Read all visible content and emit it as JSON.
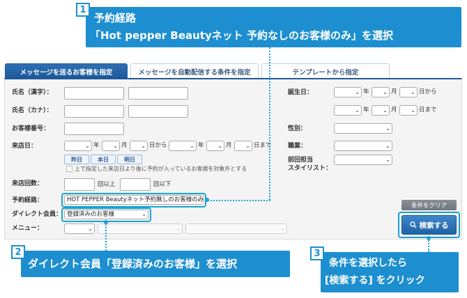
{
  "tabs": [
    {
      "label": "メッセージを送るお客様を指定"
    },
    {
      "label": "メッセージを自動配信する条件を指定"
    },
    {
      "label": "テンプレートから指定"
    }
  ],
  "form": {
    "name_kanji": "氏名（漢字）：",
    "name_kana": "氏名（カナ）：",
    "customer_no": "お客様番号：",
    "visit_date": "来店日：",
    "visit_count": "来店回数：",
    "route": "予約経路：",
    "direct_member": "ダイレクト会員：",
    "menu": "メニュー：",
    "birthday": "誕生日：",
    "gender": "性別：",
    "occupation": "職業：",
    "last_stylist_1": "前回担当",
    "last_stylist_2": "スタイリスト：",
    "unit_year": "年",
    "unit_month": "月",
    "unit_day_from": "日から",
    "unit_day_to": "日まで",
    "count_min_unit": "回以上",
    "count_max_unit": "回以下",
    "btn_yesterday": "昨日",
    "btn_today": "本日",
    "btn_tomorrow": "明日",
    "future_booking_note": "上で指定した来店日より後に予約が入っているお客様を対象外とする",
    "route_value": "HOT PEPPER Beautyネット予約無しのお客様のみ",
    "direct_member_value": "登録済みのお客様"
  },
  "buttons": {
    "clear": "条件をクリア",
    "search": "検索する"
  },
  "callouts": {
    "c1_num": "1",
    "c1_line1": "予約経路",
    "c1_line2": "「Hot pepper Beautyネット 予約なしのお客様のみ」を選択",
    "c2_num": "2",
    "c2_text": "ダイレクト会員「登録済みのお客様」を選択",
    "c3_num": "3",
    "c3_line1": "条件を選択したら",
    "c3_line2": "[検索する] をクリック"
  },
  "colors": {
    "accent": "#1d8fd0",
    "tab_active": "#1d5899",
    "highlight": "#19a3d6"
  }
}
